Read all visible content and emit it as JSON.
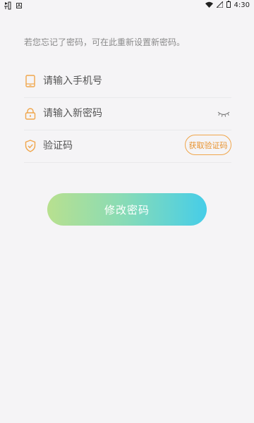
{
  "status_bar": {
    "time": "4:30",
    "left_icons": [
      "app-notification-icon",
      "system-notification-icon"
    ],
    "right_icons": [
      "wifi-icon",
      "signal-icon",
      "battery-icon"
    ]
  },
  "hint": "若您忘记了密码，可在此重新设置新密码。",
  "fields": {
    "phone": {
      "placeholder": "请输入手机号",
      "icon": "phone-icon"
    },
    "password": {
      "placeholder": "请输入新密码",
      "icon": "lock-icon",
      "toggle_icon": "eye-closed-icon"
    },
    "code": {
      "placeholder": "验证码",
      "icon": "shield-icon",
      "button_label": "获取验证码"
    }
  },
  "submit_label": "修改密码",
  "colors": {
    "accent_orange": "#f0a64c",
    "gradient_start": "#b8e08f",
    "gradient_end": "#46cde8",
    "background": "#f5f4f6"
  }
}
